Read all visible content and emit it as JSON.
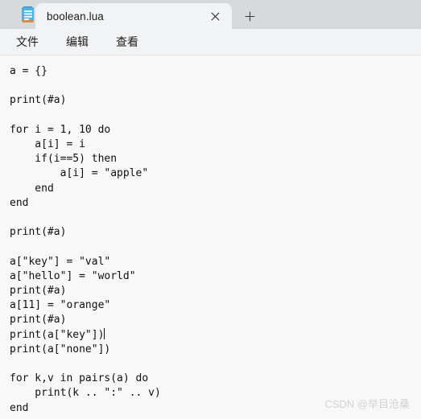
{
  "window": {
    "app_name": "Notepad",
    "app_icon": "notepad-icon",
    "titlebar_color": "#d7dadd",
    "menubar_color": "#f2f3f5",
    "editor_color": "#f8f8f8"
  },
  "tabstrip": {
    "tabs": [
      {
        "label": "boolean.lua",
        "active": true,
        "close_icon": "close-icon"
      }
    ],
    "new_tab_icon": "plus-icon",
    "new_tab_label": "+"
  },
  "menubar": {
    "items": [
      {
        "label": "文件"
      },
      {
        "label": "编辑"
      },
      {
        "label": "查看"
      }
    ]
  },
  "editor": {
    "language": "lua",
    "caret_line": 17,
    "caret_column": 16,
    "lines": [
      "a = {}",
      "",
      "print(#a)",
      "",
      "for i = 1, 10 do",
      "    a[i] = i",
      "    if(i==5) then",
      "        a[i] = \"apple\"",
      "    end",
      "end",
      "",
      "print(#a)",
      "",
      "a[\"key\"] = \"val\"",
      "a[\"hello\"] = \"world\"",
      "print(#a)",
      "a[11] = \"orange\"",
      "print(#a)",
      "print(a[\"key\"])",
      "print(a[\"none\"])",
      "",
      "for k,v in pairs(a) do",
      "    print(k .. \":\" .. v)",
      "end"
    ],
    "text_before_caret": "a = {}\n\nprint(#a)\n\nfor i = 1, 10 do\n    a[i] = i\n    if(i==5) then\n        a[i] = \"apple\"\n    end\nend\n\nprint(#a)\n\na[\"key\"] = \"val\"\na[\"hello\"] = \"world\"\nprint(#a)\na[11] = \"orange\"\nprint(#a)\nprint(a[\"key\"])",
    "text_after_caret": "\nprint(a[\"none\"])\n\nfor k,v in pairs(a) do\n    print(k .. \":\" .. v)\nend"
  },
  "watermark": {
    "text": "CSDN @举目沧桑"
  }
}
